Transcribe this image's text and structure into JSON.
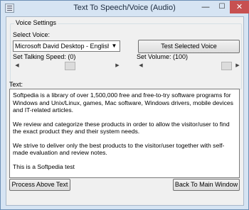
{
  "window": {
    "title": "Text To Speech/Voice (Audio)",
    "minimize_glyph": "—",
    "maximize_glyph": "☐",
    "close_glyph": "✕"
  },
  "voice_settings": {
    "group_label": "Voice Settings",
    "select_voice_label": "Select Voice:",
    "selected_voice": "Microsoft David Desktop - English (Unit",
    "test_button": "Test Selected Voice",
    "speed_label": "Set Talking Speed: (0)",
    "volume_label": "Set Volume: (100)",
    "speed_value": 0,
    "volume_value": 100
  },
  "text_section": {
    "label": "Text:",
    "paragraphs": [
      "Softpedia is a library of over 1,500,000 free and free-to-try software programs for Windows and Unix/Linux, games, Mac software, Windows drivers, mobile devices and IT-related articles.",
      "We review and categorize these products in order to allow the visitor/user to find the exact product they and their system needs.",
      "We strive to deliver only the best products to the visitor/user together with self-made evaluation and review notes.",
      "This is a Softpedia test"
    ]
  },
  "buttons": {
    "process": "Process Above Text",
    "back": "Back To Main Window"
  }
}
